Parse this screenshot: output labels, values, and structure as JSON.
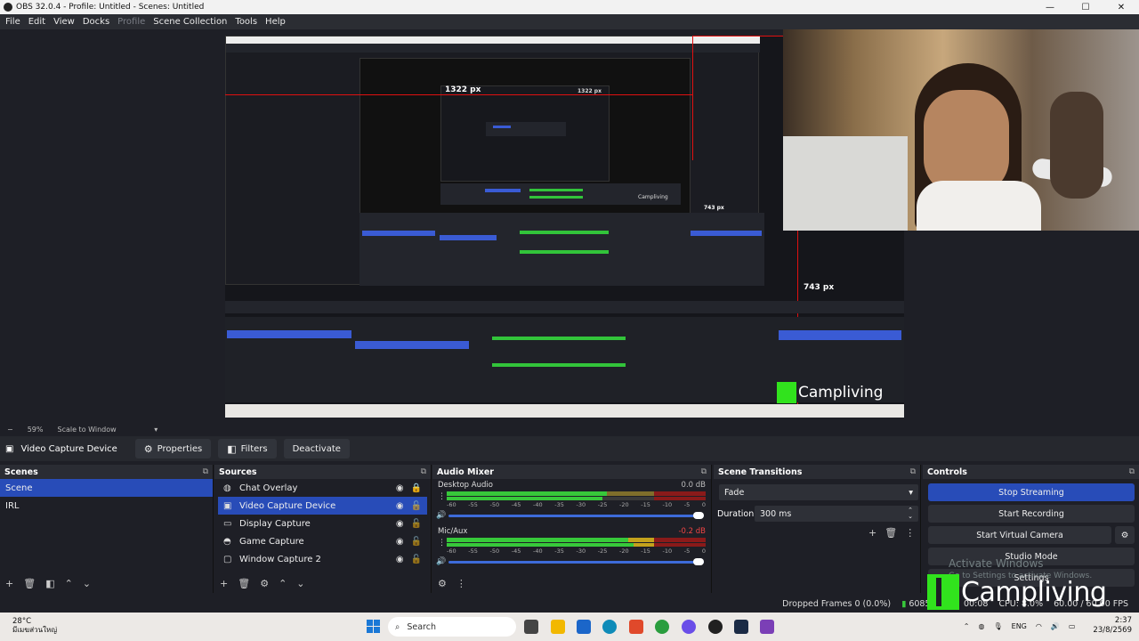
{
  "window": {
    "title": "OBS 32.0.4 - Profile: Untitled - Scenes: Untitled",
    "controls": [
      "—",
      "☐",
      "✕"
    ]
  },
  "menu": [
    {
      "label": "File",
      "disabled": false
    },
    {
      "label": "Edit",
      "disabled": false
    },
    {
      "label": "View",
      "disabled": false
    },
    {
      "label": "Docks",
      "disabled": false
    },
    {
      "label": "Profile",
      "disabled": true
    },
    {
      "label": "Scene Collection",
      "disabled": false
    },
    {
      "label": "Tools",
      "disabled": false
    },
    {
      "label": "Help",
      "disabled": false
    }
  ],
  "preview": {
    "width_label": "1322 px",
    "height_label": "743 px",
    "nested_width_label": "1322 px",
    "nested_height_label": "743 px",
    "nested_watermark": "Campliving",
    "nested_watermark_small": "Campliving"
  },
  "zoom": {
    "level": "59%",
    "mode": "Scale to Window",
    "minus": "−"
  },
  "source_toolbar": {
    "source_name": "Video Capture Device",
    "properties": "Properties",
    "filters": "Filters",
    "deactivate": "Deactivate"
  },
  "scenes": {
    "title": "Scenes",
    "items": [
      "Scene",
      "IRL"
    ],
    "selected_index": 0
  },
  "sources": {
    "title": "Sources",
    "items": [
      {
        "label": "Chat Overlay",
        "icon": "globe-icon",
        "locked": true
      },
      {
        "label": "Video Capture Device",
        "icon": "camera-icon",
        "locked": false
      },
      {
        "label": "Display Capture",
        "icon": "monitor-icon",
        "locked": false
      },
      {
        "label": "Game Capture",
        "icon": "gamepad-icon",
        "locked": false
      },
      {
        "label": "Window Capture 2",
        "icon": "window-icon",
        "locked": false
      }
    ],
    "selected_index": 1
  },
  "audio_mixer": {
    "title": "Audio Mixer",
    "channels": [
      {
        "name": "Desktop Audio",
        "db": "0.0 dB",
        "level": 0.62
      },
      {
        "name": "Mic/Aux",
        "db": "-0.2 dB",
        "level": 0.78
      }
    ],
    "scale": [
      "-60",
      "-55",
      "-50",
      "-45",
      "-40",
      "-35",
      "-30",
      "-25",
      "-20",
      "-15",
      "-10",
      "-5",
      "0"
    ]
  },
  "scene_transitions": {
    "title": "Scene Transitions",
    "transition": "Fade",
    "duration_label": "Duration",
    "duration_value": "300 ms"
  },
  "controls": {
    "title": "Controls",
    "stop_streaming": "Stop Streaming",
    "start_recording": "Start Recording",
    "start_virtual_camera": "Start Virtual Camera",
    "studio_mode": "Studio Mode",
    "settings": "Settings"
  },
  "activation": {
    "title": "Activate Windows",
    "subtitle": "Go to Settings to activate Windows."
  },
  "watermark": "Campliving",
  "status": {
    "dropped_frames": "Dropped Frames 0 (0.0%)",
    "bitrate": "6085 kbps",
    "stream_time": "00:08",
    "cpu": "CPU: 8.0%",
    "fps": "60.00 / 60.00 FPS"
  },
  "taskbar": {
    "temperature": "28°C",
    "weather_text": "มีเมฆส่วนใหญ่",
    "search_placeholder": "Search",
    "lang": "ENG",
    "time": "2:37",
    "date": "23/8/2569"
  },
  "colors": {
    "accent": "#284cb8",
    "meter_green": "#37c93a",
    "meter_yellow": "#c4a21c",
    "meter_red": "#8a1a1a",
    "guide_red": "#e01010",
    "brand_green": "#31e31d"
  }
}
